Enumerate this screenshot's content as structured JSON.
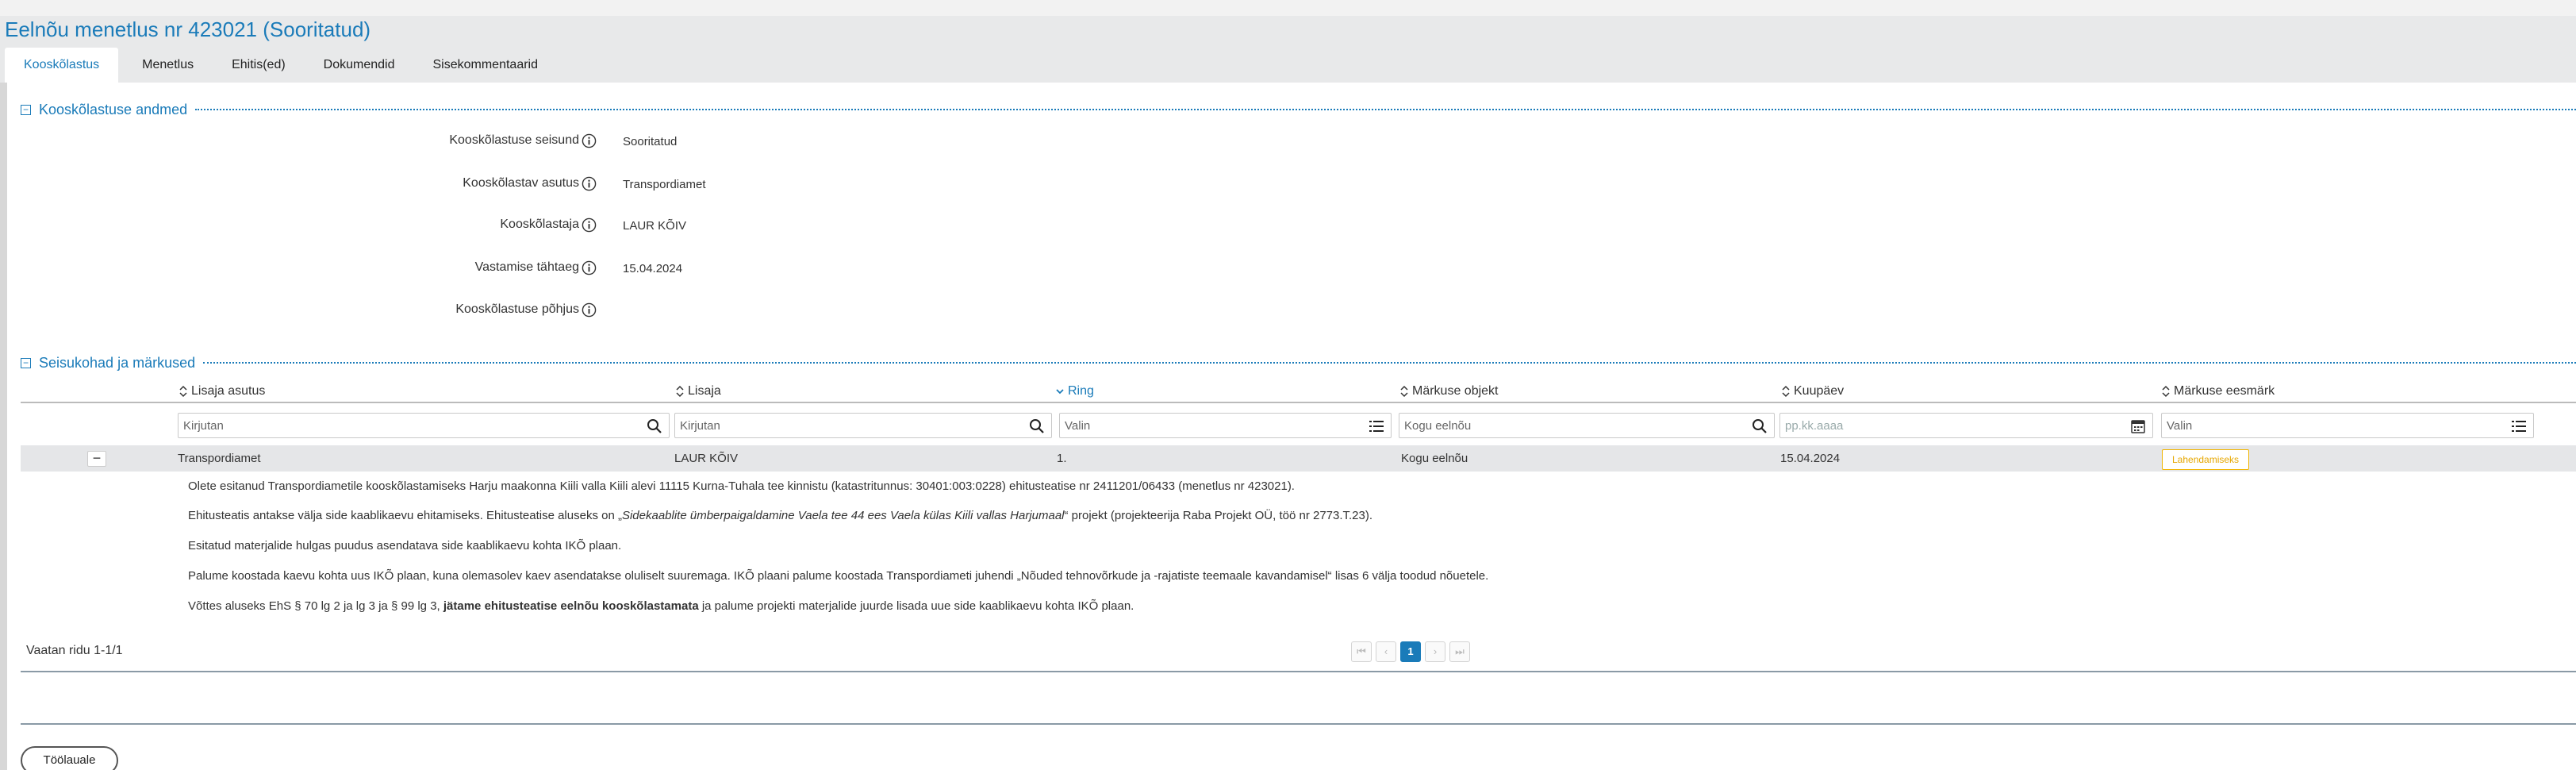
{
  "page": {
    "title": "Eelnõu menetlus nr 423021 (Sooritatud)"
  },
  "tabs": [
    {
      "label": "Kooskõlastus",
      "active": true
    },
    {
      "label": "Menetlus",
      "active": false
    },
    {
      "label": "Ehitis(ed)",
      "active": false
    },
    {
      "label": "Dokumendid",
      "active": false
    },
    {
      "label": "Sisekommentaarid",
      "active": false
    }
  ],
  "section1": {
    "title": "Kooskõlastuse andmed",
    "collapse_symbol": "−",
    "fields": [
      {
        "label": "Kooskõlastuse seisund",
        "value": "Sooritatud"
      },
      {
        "label": "Kooskõlastav asutus",
        "value": "Transpordiamet"
      },
      {
        "label": "Kooskõlastaja",
        "value": "LAUR KÕIV"
      },
      {
        "label": "Vastamise tähtaeg",
        "value": "15.04.2024"
      },
      {
        "label": "Kooskõlastuse põhjus",
        "value": ""
      }
    ]
  },
  "section2": {
    "title": "Seisukohad ja märkused",
    "collapse_symbol": "−",
    "columns": [
      {
        "label": "Lisaja asutus",
        "sorted": false
      },
      {
        "label": "Lisaja",
        "sorted": false
      },
      {
        "label": "Ring",
        "sorted": true
      },
      {
        "label": "Märkuse objekt",
        "sorted": false
      },
      {
        "label": "Kuupäev",
        "sorted": false
      },
      {
        "label": "Märkuse eesmärk",
        "sorted": false
      }
    ],
    "filters": [
      {
        "placeholder": "Kirjutan",
        "icon": "search-icon"
      },
      {
        "placeholder": "Kirjutan",
        "icon": "search-icon"
      },
      {
        "placeholder": "Valin",
        "icon": "list-icon"
      },
      {
        "placeholder": "Kogu eelnõu",
        "icon": "search-icon"
      },
      {
        "placeholder": "pp.kk.aaaa",
        "icon": "calendar-icon"
      },
      {
        "placeholder": "Valin",
        "icon": "list-icon"
      }
    ],
    "row": {
      "expand_symbol": "−",
      "asutus": "Transpordiamet",
      "lisaja": "LAUR KÕIV",
      "ring": "1.",
      "objekt": "Kogu eelnõu",
      "kuupaev": "15.04.2024",
      "eesmark": "Lahendamiseks"
    },
    "comment": {
      "p1": "Olete esitanud Transpordiametile kooskõlastamiseks Harju maakonna Kiili valla Kiili alevi 11115 Kurna-Tuhala tee kinnistu (katastritunnus: 30401:003:0228) ehitusteatise nr 2411201/06433 (menetlus nr 423021).",
      "p2a": "Ehitusteatis antakse välja side kaablikaevu ehitamiseks. Ehitusteatise aluseks on „",
      "p2b": "Sidekaablite ümberpaigaldamine Vaela tee 44 ees Vaela külas Kiili vallas Harjumaal",
      "p2c": "“ projekt (projekteerija Raba Projekt OÜ, töö nr 2773.T.23).",
      "p3": "Esitatud materjalide hulgas puudus asendatava side kaablikaevu kohta IKÕ plaan.",
      "p4": "Palume koostada kaevu kohta uus IKÕ plaan, kuna olemasolev kaev asendatakse oluliselt suuremaga. IKÕ plaani palume koostada Transpordiameti juhendi „Nõuded tehnovõrkude ja -rajatiste teemaale kavandamisel“ lisas 6 välja toodud nõuetele.",
      "p5a": "Võttes aluseks EhS § 70 lg 2 ja lg 3 ja § 99 lg 3, ",
      "p5b": "jätame ehitusteatise eelnõu kooskõlastamata",
      "p5c": " ja palume projekti materjalide juurde lisada uue side kaablikaevu kohta IKÕ plaan."
    },
    "rows_info": "Vaatan ridu 1-1/1",
    "pager": {
      "first": "⏮",
      "prev": "‹",
      "current": "1",
      "next": "›",
      "last": "⏭"
    }
  },
  "footer": {
    "home_button": "Töölauale"
  },
  "colors": {
    "accent": "#1a7bb9",
    "badge": "#f0b400",
    "row_bg": "#e5e6e8",
    "header_bg": "#e8e9ea"
  }
}
